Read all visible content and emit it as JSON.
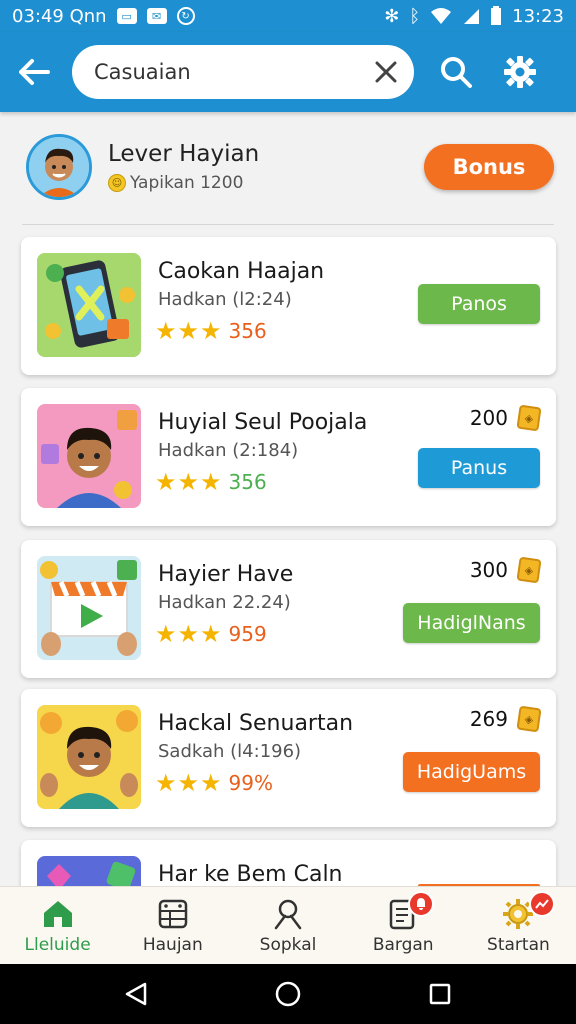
{
  "status_bar": {
    "time_left": "03:49 Qnn",
    "time_right": "13:23"
  },
  "search": {
    "value": "Casuaian",
    "placeholder": "Casuaian"
  },
  "profile": {
    "name": "Lever Hayian",
    "subtitle": "Yapikan 1200",
    "bonus_label": "Bonus"
  },
  "colors": {
    "primary": "#1e8fd0",
    "orange": "#f37021",
    "green": "#6cb84a",
    "blue": "#1e9bd7",
    "star": "#f5b400"
  },
  "games": [
    {
      "title": "Caokan Haajan",
      "subtitle": "Hadkan (l2:24)",
      "rating": "356",
      "rating_color": "#e8601c",
      "price": "",
      "button_label": "Panos",
      "button_color": "#6cb84a",
      "icon": "phone-game-icon"
    },
    {
      "title": "Huyial Seul Poojala",
      "subtitle": "Hadkan (2:184)",
      "rating": "356",
      "rating_color": "#4caf50",
      "price": "200",
      "button_label": "Panus",
      "button_color": "#1e9bd7",
      "icon": "boy-avatar-icon"
    },
    {
      "title": "Hayier Have",
      "subtitle": "Hadkan 22.24)",
      "rating": "959",
      "rating_color": "#e8601c",
      "price": "300",
      "button_label": "HadiglNans",
      "button_color": "#6cb84a",
      "icon": "video-play-icon"
    },
    {
      "title": "Hackal Senuartan",
      "subtitle": "Sadkah (l4:196)",
      "rating": "99%",
      "rating_color": "#e8601c",
      "price": "269",
      "button_label": "HadigUams",
      "button_color": "#f37021",
      "icon": "boy-waving-icon"
    },
    {
      "title": "Har ke Bem Caln",
      "subtitle": "",
      "rating": "",
      "rating_color": "#e8601c",
      "price": "",
      "button_label": "",
      "button_color": "#f37021",
      "icon": "gems-icon"
    }
  ],
  "bottom_nav": [
    {
      "label": "Lleluide",
      "icon": "home-icon",
      "active": true
    },
    {
      "label": "Haujan",
      "icon": "grid-icon",
      "active": false
    },
    {
      "label": "Sopkal",
      "icon": "person-search-icon",
      "active": false
    },
    {
      "label": "Bargan",
      "icon": "document-icon",
      "active": false,
      "badge": "bell"
    },
    {
      "label": "Startan",
      "icon": "gear-sun-icon",
      "active": false,
      "badge": "trend"
    }
  ]
}
